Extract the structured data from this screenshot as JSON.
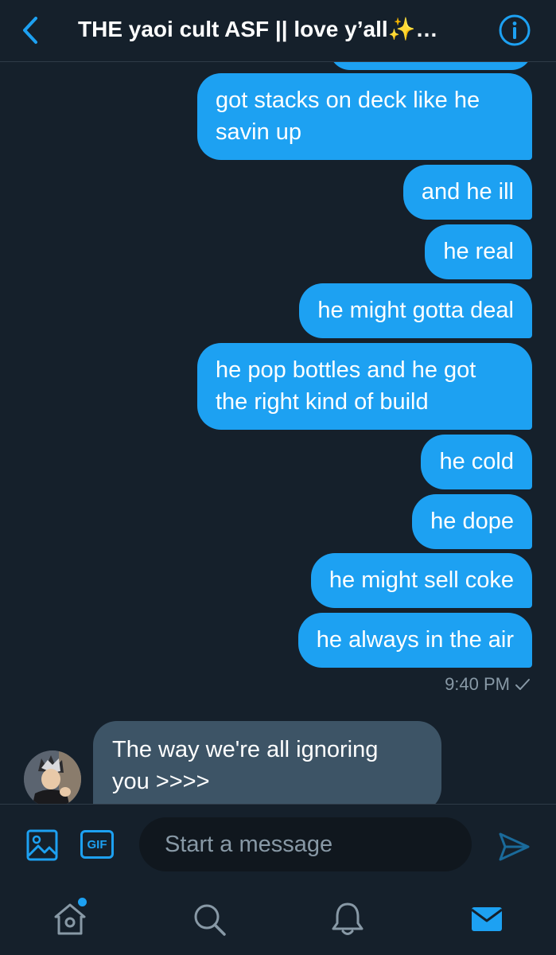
{
  "header": {
    "title": "THE yaoi cult ASF || love y’all✨…",
    "back_icon": "chevron-left-icon",
    "info_icon": "info-icon"
  },
  "messages_outgoing": [
    {
      "text_lines": [
        "got stacks on deck like he",
        "savin up"
      ]
    },
    {
      "text_lines": [
        "and he ill"
      ]
    },
    {
      "text_lines": [
        "he real"
      ]
    },
    {
      "text_lines": [
        "he might gotta deal"
      ]
    },
    {
      "text_lines": [
        "he pop bottles and he got",
        "the right kind of build"
      ]
    },
    {
      "text_lines": [
        "he cold"
      ]
    },
    {
      "text_lines": [
        "he dope"
      ]
    },
    {
      "text_lines": [
        "he might sell coke"
      ]
    },
    {
      "text_lines": [
        "he always in the air"
      ]
    }
  ],
  "timestamp": "9:40 PM",
  "timestamp_status_icon": "checkmark-icon",
  "message_incoming": {
    "text_lines": [
      "The   way we're all ignoring",
      "you >>>>"
    ],
    "avatar_icon": "avatar"
  },
  "composer": {
    "placeholder": "Start a message",
    "gif_label": "GIF",
    "image_icon": "image-icon",
    "send_icon": "send-icon"
  },
  "tabbar": {
    "items": [
      "home-icon",
      "search-icon",
      "bell-icon",
      "mail-icon"
    ],
    "home_has_notification": true
  },
  "colors": {
    "background": "#15202b",
    "accent": "#1da1f2",
    "incoming_bubble": "#3d5466",
    "muted_text": "#8899a6"
  }
}
